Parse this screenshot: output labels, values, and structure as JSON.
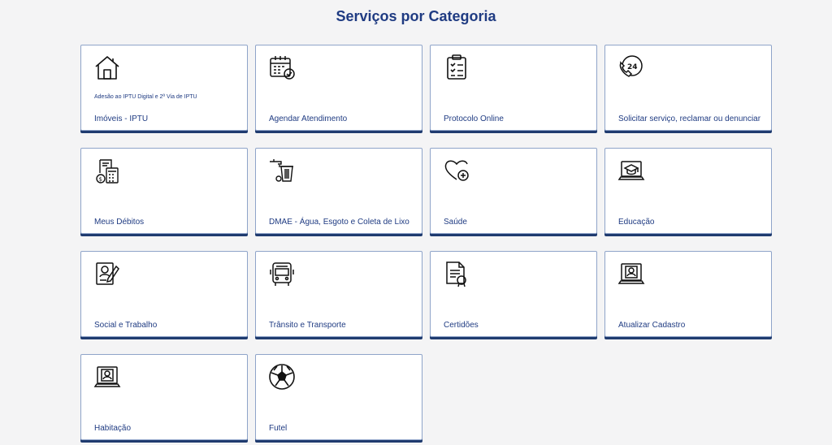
{
  "header": {
    "title": "Serviços por Categoria"
  },
  "cards": [
    {
      "icon": "house-icon",
      "label": "Imóveis - IPTU",
      "subtitle": "Adesão ao IPTU Digital e 2ª Via de IPTU"
    },
    {
      "icon": "calendar-check-icon",
      "label": "Agendar Atendimento"
    },
    {
      "icon": "clipboard-checklist-icon",
      "label": "Protocolo Online"
    },
    {
      "icon": "phone-24h-icon",
      "label": "Solicitar serviço, reclamar ou denunciar"
    },
    {
      "icon": "calculator-money-icon",
      "label": "Meus Débitos"
    },
    {
      "icon": "faucet-trash-icon",
      "label": "DMAE - Água, Esgoto e Coleta de Lixo"
    },
    {
      "icon": "heart-plus-icon",
      "label": "Saúde"
    },
    {
      "icon": "laptop-graduation-cap-icon",
      "label": "Educação"
    },
    {
      "icon": "document-person-pen-icon",
      "label": "Social e Trabalho"
    },
    {
      "icon": "bus-icon",
      "label": "Trânsito e Transporte"
    },
    {
      "icon": "certificate-document-icon",
      "label": "Certidões"
    },
    {
      "icon": "laptop-profile-icon",
      "label": "Atualizar Cadastro"
    },
    {
      "icon": "laptop-profile-icon",
      "label": "Habitação"
    },
    {
      "icon": "soccer-ball-icon",
      "label": "Futel"
    }
  ]
}
